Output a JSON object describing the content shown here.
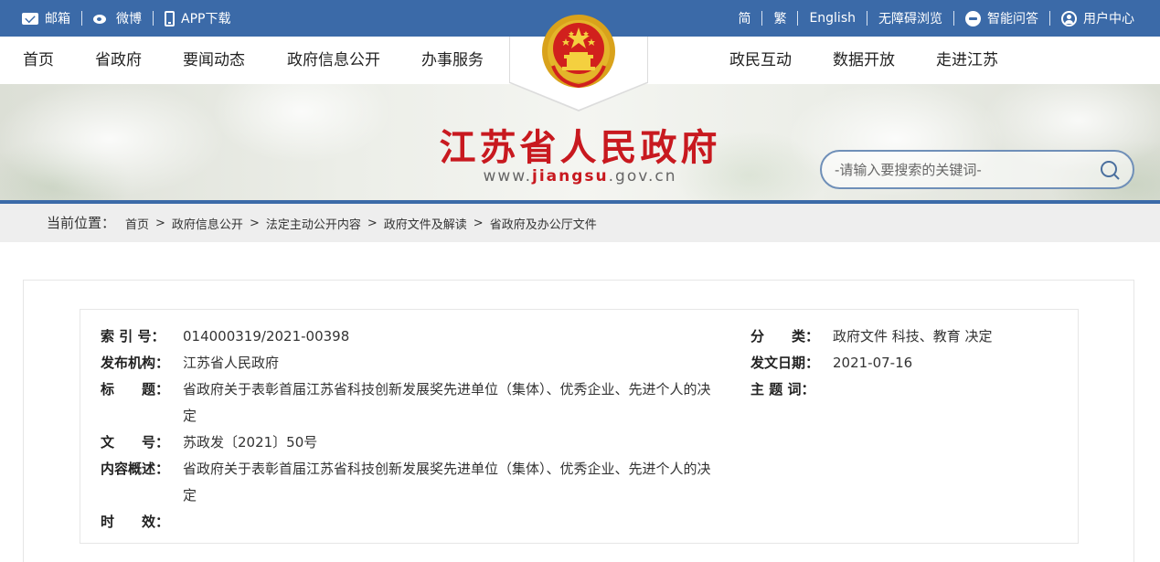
{
  "topbar": {
    "left": [
      {
        "icon": "mail-icon",
        "label": "邮箱"
      },
      {
        "icon": "weibo-icon",
        "label": "微博"
      },
      {
        "icon": "phone-icon",
        "label": "APP下载"
      }
    ],
    "right": {
      "simplified": "简",
      "traditional": "繁",
      "english": "English",
      "accessibility": "无障碍浏览",
      "qa": "智能问答",
      "user_center": "用户中心"
    }
  },
  "nav": {
    "left": [
      "首页",
      "省政府",
      "要闻动态",
      "政府信息公开",
      "办事服务"
    ],
    "right": [
      "政民互动",
      "数据开放",
      "走进江苏"
    ]
  },
  "banner": {
    "title": "江苏省人民政府",
    "url_prefix": "www.",
    "url_brand": "jiangsu",
    "url_suffix": ".gov.cn"
  },
  "search": {
    "placeholder": "-请输入要搜索的关键词-"
  },
  "breadcrumb": {
    "label": "当前位置：",
    "items": [
      "首页",
      "政府信息公开",
      "法定主动公开内容",
      "政府文件及解读",
      "省政府及办公厅文件"
    ],
    "separator": ">"
  },
  "doc": {
    "index_label": "索 引 号：",
    "index_value": "014000319/2021-00398",
    "category_label": "分　　类：",
    "category_value": "政府文件 科技、教育 决定",
    "publisher_label": "发布机构：",
    "publisher_value": "江苏省人民政府",
    "date_label": "发文日期：",
    "date_value": "2021-07-16",
    "title_label": "标　　题：",
    "title_value_line1": "省政府关于表彰首届江苏省科技创新发展奖先进单位（集体）、优秀企业、先进个人的决",
    "title_value_line2": "定",
    "subject_label": "主 题 词：",
    "subject_value": "",
    "docno_label": "文　　号：",
    "docno_value": "苏政发〔2021〕50号",
    "summary_label": "内容概述：",
    "summary_value_line1": "省政府关于表彰首届江苏省科技创新发展奖先进单位（集体）、优秀企业、先进个人的决",
    "summary_value_line2": "定",
    "validity_label": "时　　效：",
    "validity_value": ""
  },
  "colors": {
    "topbar": "#3b6aa8",
    "title_red": "#c8191f",
    "crumb_bg": "#eeeeee"
  }
}
